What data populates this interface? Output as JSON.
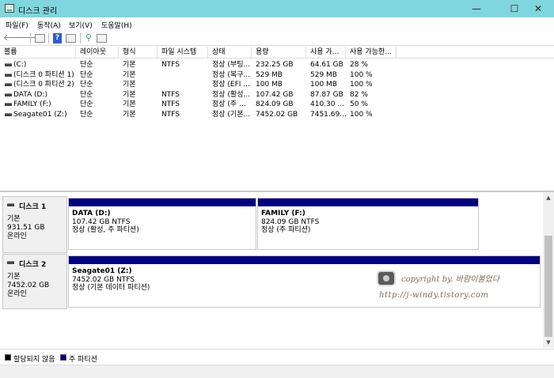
{
  "window": {
    "title": "디스크 관리",
    "min": "—",
    "max": "☐",
    "close": "✕"
  },
  "menu": [
    "파일(F)",
    "동작(A)",
    "보기(V)",
    "도움말(H)"
  ],
  "toolbar": {
    "back": "🡐",
    "forward": "🡒",
    "help": "?"
  },
  "columns": [
    "볼륨",
    "레이아웃",
    "형식",
    "파일 시스템",
    "상태",
    "용량",
    "사용 가...",
    "사용 가능한..."
  ],
  "volumes": [
    [
      "(C:)",
      "단순",
      "기본",
      "NTFS",
      "정상 (부팅...",
      "232.25 GB",
      "64.61 GB",
      "28 %"
    ],
    [
      "(디스크 0 파티션 1)",
      "단순",
      "기본",
      "",
      "정상 (복구...",
      "529 MB",
      "529 MB",
      "100 %"
    ],
    [
      "(디스크 0 파티션 2)",
      "단순",
      "기본",
      "",
      "정상 (EFI ...",
      "100 MB",
      "100 MB",
      "100 %"
    ],
    [
      "DATA (D:)",
      "단순",
      "기본",
      "NTFS",
      "정상 (활성...",
      "107.42 GB",
      "87.87 GB",
      "82 %"
    ],
    [
      "FAMILY (F:)",
      "단순",
      "기본",
      "NTFS",
      "정상 (주 ...",
      "824.09 GB",
      "410.30 ...",
      "50 %"
    ],
    [
      "Seagate01 (Z:)",
      "단순",
      "기본",
      "NTFS",
      "정상 (기본...",
      "7452.02 GB",
      "7451.69...",
      "100 %"
    ]
  ],
  "disks": [
    {
      "name": "디스크 1",
      "type": "기본",
      "size": "931.51 GB",
      "status": "온라인",
      "partitions": [
        {
          "title": "DATA  (D:)",
          "size": "107.42 GB NTFS",
          "status": "정상 (활성, 주 파티션)"
        },
        {
          "title": "FAMILY  (F:)",
          "size": "824.09 GB NTFS",
          "status": "정상 (주 파티션)"
        }
      ]
    },
    {
      "name": "디스크 2",
      "type": "기본",
      "size": "7452.02 GB",
      "status": "온라인",
      "partitions": [
        {
          "title": "Seagate01  (Z:)",
          "size": "7452.02 GB NTFS",
          "status": "정상 (기본 데이터 파티션)"
        }
      ]
    }
  ],
  "watermark": {
    "line1": "copyright by. 바람이불었다",
    "line2": "http://j-windy.tistory.com"
  },
  "legend": [
    {
      "label": "할당되지 않음",
      "color": "#000000"
    },
    {
      "label": "주 파티션",
      "color": "#000080"
    }
  ]
}
